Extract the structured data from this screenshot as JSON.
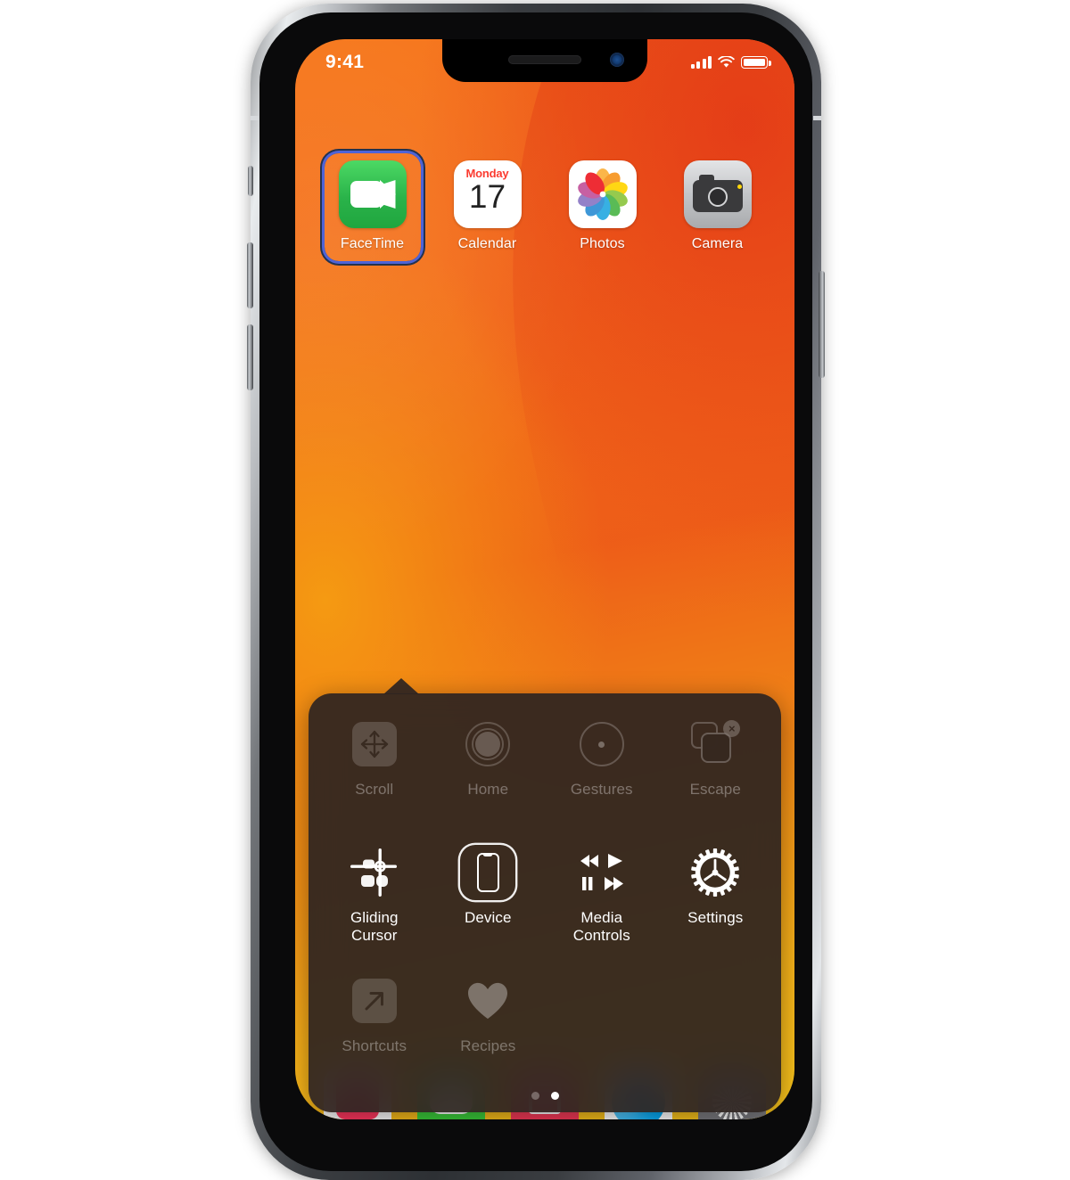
{
  "status_bar": {
    "time": "9:41",
    "signal_icon": "cellular-signal-icon",
    "wifi_icon": "wifi-icon",
    "battery_icon": "battery-icon"
  },
  "home_screen": {
    "apps": [
      {
        "label": "FaceTime",
        "icon": "facetime-icon",
        "focused": true
      },
      {
        "label": "Calendar",
        "icon": "calendar-icon",
        "focused": false,
        "weekday": "Monday",
        "date": "17"
      },
      {
        "label": "Photos",
        "icon": "photos-icon",
        "focused": false
      },
      {
        "label": "Camera",
        "icon": "camera-icon",
        "focused": false
      }
    ]
  },
  "assistive_touch_menu": {
    "items": [
      {
        "label": "Scroll",
        "icon": "scroll-arrows-icon",
        "state": "dimmed"
      },
      {
        "label": "Home",
        "icon": "home-button-icon",
        "state": "dimmed"
      },
      {
        "label": "Gestures",
        "icon": "gestures-dot-icon",
        "state": "dimmed"
      },
      {
        "label": "Escape",
        "icon": "escape-windows-icon",
        "state": "dimmed"
      },
      {
        "label": "Gliding\nCursor",
        "icon": "gliding-cursor-icon",
        "state": "active"
      },
      {
        "label": "Device",
        "icon": "device-phone-icon",
        "state": "selected"
      },
      {
        "label": "Media\nControls",
        "icon": "media-controls-icon",
        "state": "active"
      },
      {
        "label": "Settings",
        "icon": "settings-gear-icon",
        "state": "active"
      },
      {
        "label": "Shortcuts",
        "icon": "shortcuts-arrow-icon",
        "state": "dimmed"
      },
      {
        "label": "Recipes",
        "icon": "heart-icon",
        "state": "dimmed"
      }
    ],
    "pages": {
      "count": 2,
      "current": 2
    }
  },
  "colors": {
    "wallpaper_orange": "#f4701b",
    "wallpaper_red": "#e8441a",
    "wallpaper_yellow": "#f8c51c",
    "panel_background": "#2d2420",
    "focus_ring": "#4f63d6",
    "facetime_green": "#2ab34a",
    "calendar_red": "#fb3b30",
    "label_white": "#ffffff"
  }
}
